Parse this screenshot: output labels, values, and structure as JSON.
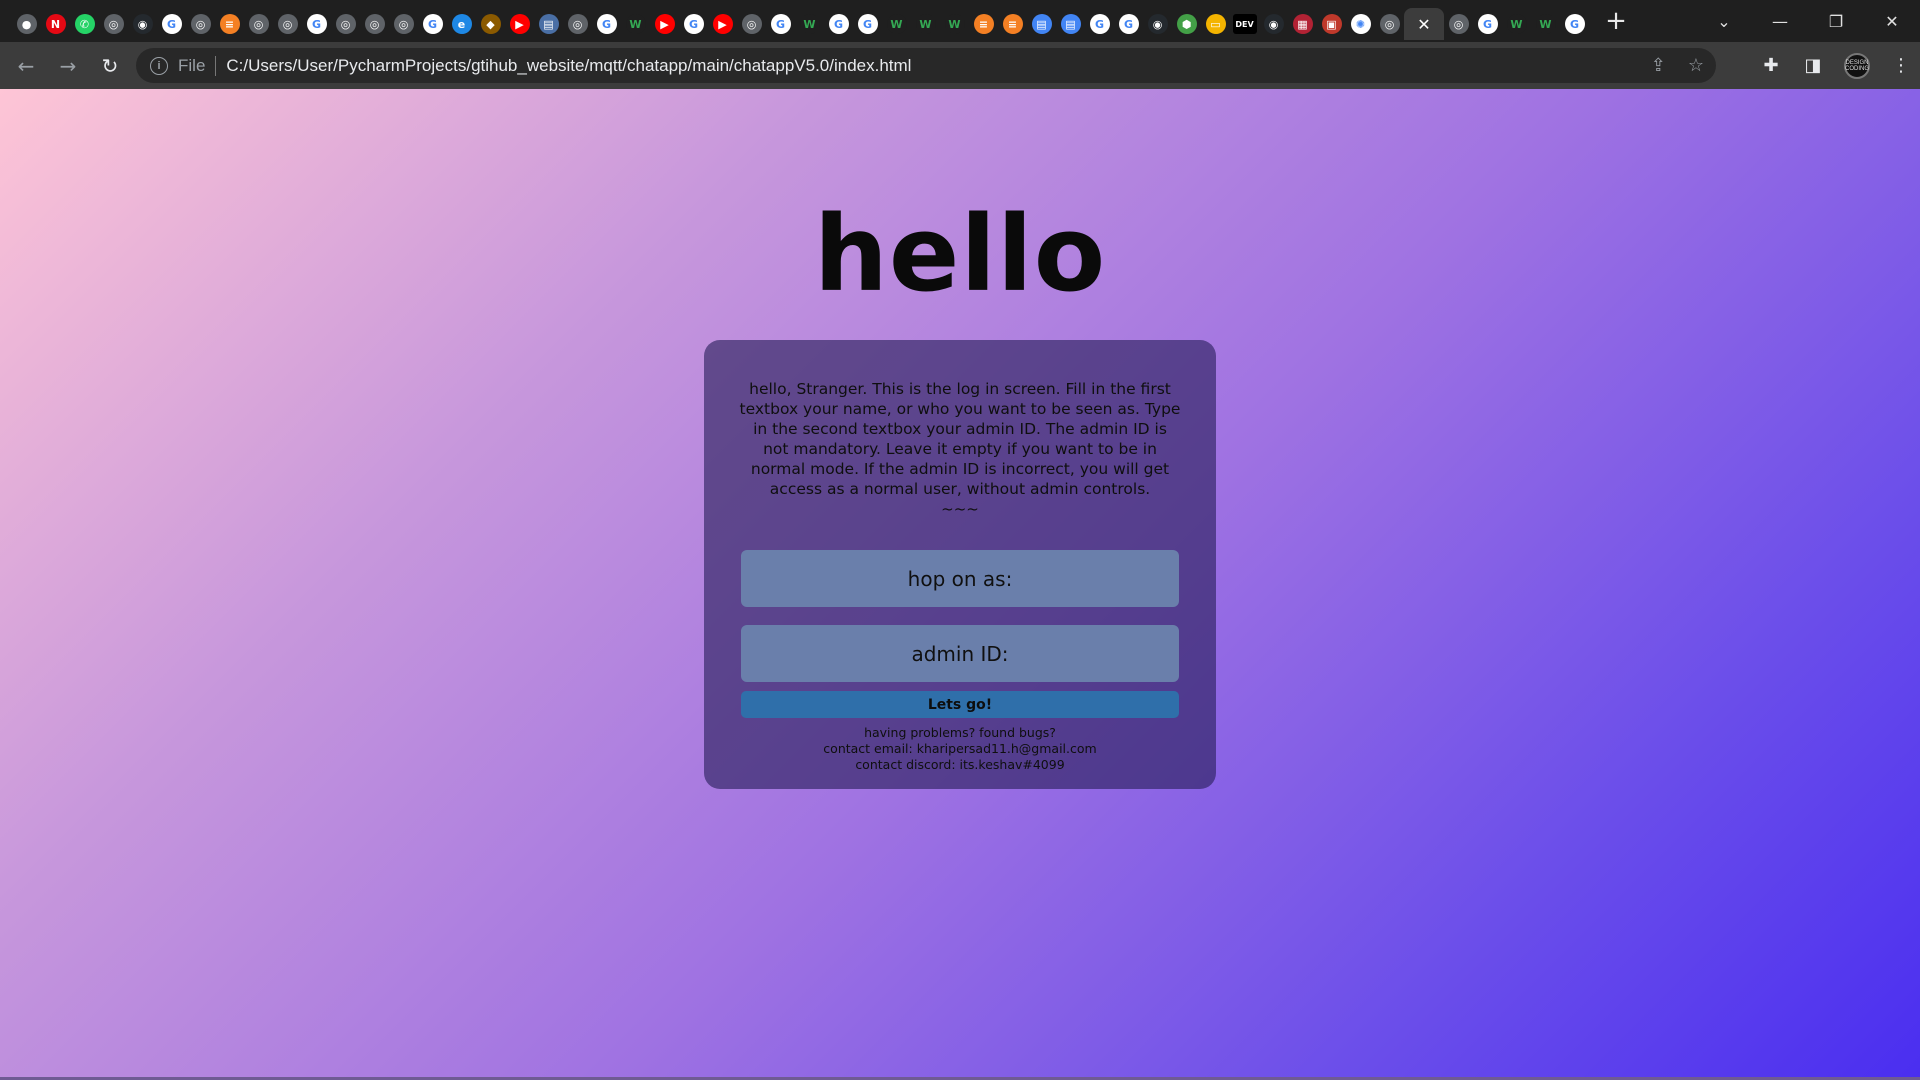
{
  "tabs": [
    {
      "icon": "chrome-icon",
      "color": "#5f6368",
      "glyph": "●"
    },
    {
      "icon": "netflix-icon",
      "color": "#e50914",
      "glyph": "N"
    },
    {
      "icon": "whatsapp-icon",
      "color": "#25d366",
      "glyph": "✆"
    },
    {
      "icon": "globe-icon",
      "color": "#5f6368",
      "glyph": "◎"
    },
    {
      "icon": "github-icon",
      "color": "#24292e",
      "glyph": "◉"
    },
    {
      "icon": "google-icon",
      "color": "#ffffff",
      "glyph": "G"
    },
    {
      "icon": "globe-icon",
      "color": "#5f6368",
      "glyph": "◎"
    },
    {
      "icon": "stackoverflow-icon",
      "color": "#f48024",
      "glyph": "≡"
    },
    {
      "icon": "globe-icon",
      "color": "#5f6368",
      "glyph": "◎"
    },
    {
      "icon": "globe-icon",
      "color": "#5f6368",
      "glyph": "◎"
    },
    {
      "icon": "google-icon",
      "color": "#ffffff",
      "glyph": "G"
    },
    {
      "icon": "globe-icon",
      "color": "#5f6368",
      "glyph": "◎"
    },
    {
      "icon": "globe-icon",
      "color": "#5f6368",
      "glyph": "◎"
    },
    {
      "icon": "globe-icon",
      "color": "#5f6368",
      "glyph": "◎"
    },
    {
      "icon": "google-icon",
      "color": "#ffffff",
      "glyph": "G"
    },
    {
      "icon": "edge-icon",
      "color": "#1e88e5",
      "glyph": "e"
    },
    {
      "icon": "shield-icon",
      "color": "#8b5a00",
      "glyph": "◆"
    },
    {
      "icon": "youtube-icon",
      "color": "#ff0000",
      "glyph": "▶"
    },
    {
      "icon": "document-icon",
      "color": "#4a6fa5",
      "glyph": "▤"
    },
    {
      "icon": "globe-icon",
      "color": "#5f6368",
      "glyph": "◎"
    },
    {
      "icon": "google-icon",
      "color": "#ffffff",
      "glyph": "G"
    },
    {
      "icon": "w-icon",
      "color": "#1f1f1f",
      "glyph": "W"
    },
    {
      "icon": "youtube-icon",
      "color": "#ff0000",
      "glyph": "▶"
    },
    {
      "icon": "google-icon",
      "color": "#ffffff",
      "glyph": "G"
    },
    {
      "icon": "youtube-icon",
      "color": "#ff0000",
      "glyph": "▶"
    },
    {
      "icon": "globe-icon",
      "color": "#5f6368",
      "glyph": "◎"
    },
    {
      "icon": "google-icon",
      "color": "#ffffff",
      "glyph": "G"
    },
    {
      "icon": "w-icon",
      "color": "#1f1f1f",
      "glyph": "W"
    },
    {
      "icon": "google-icon",
      "color": "#ffffff",
      "glyph": "G"
    },
    {
      "icon": "google-icon",
      "color": "#ffffff",
      "glyph": "G"
    },
    {
      "icon": "w-icon",
      "color": "#1f1f1f",
      "glyph": "W"
    },
    {
      "icon": "w-icon",
      "color": "#1f1f1f",
      "glyph": "W"
    },
    {
      "icon": "w-icon",
      "color": "#1f1f1f",
      "glyph": "W"
    },
    {
      "icon": "stackoverflow-icon",
      "color": "#f48024",
      "glyph": "≡"
    },
    {
      "icon": "stackoverflow-icon",
      "color": "#f48024",
      "glyph": "≡"
    },
    {
      "icon": "docs-icon",
      "color": "#4285f4",
      "glyph": "▤"
    },
    {
      "icon": "docs-icon",
      "color": "#4285f4",
      "glyph": "▤"
    },
    {
      "icon": "google-icon",
      "color": "#ffffff",
      "glyph": "G"
    },
    {
      "icon": "google-icon",
      "color": "#ffffff",
      "glyph": "G"
    },
    {
      "icon": "github-icon",
      "color": "#24292e",
      "glyph": "◉"
    },
    {
      "icon": "cube-icon",
      "color": "#43a047",
      "glyph": "⬢"
    },
    {
      "icon": "slides-icon",
      "color": "#f4b400",
      "glyph": "▭"
    },
    {
      "icon": "dev-icon",
      "color": "#000000",
      "glyph": "DEV"
    },
    {
      "icon": "github-icon",
      "color": "#24292e",
      "glyph": "◉"
    },
    {
      "icon": "flag-icon",
      "color": "#b22234",
      "glyph": "▦"
    },
    {
      "icon": "calendar-icon",
      "color": "#c0392b",
      "glyph": "▣"
    },
    {
      "icon": "openai-icon",
      "color": "#ffffff",
      "glyph": "✺"
    },
    {
      "icon": "globe-icon",
      "color": "#5f6368",
      "glyph": "◎"
    },
    {
      "icon": "close-icon",
      "color": "#3c3c3c",
      "glyph": "✕",
      "active": true
    },
    {
      "icon": "globe-icon",
      "color": "#5f6368",
      "glyph": "◎"
    },
    {
      "icon": "google-icon",
      "color": "#ffffff",
      "glyph": "G"
    },
    {
      "icon": "w-icon",
      "color": "#1f1f1f",
      "glyph": "W"
    },
    {
      "icon": "w-icon",
      "color": "#1f1f1f",
      "glyph": "W"
    },
    {
      "icon": "google-icon",
      "color": "#ffffff",
      "glyph": "G"
    }
  ],
  "tabstrip": {
    "new_tab_glyph": "+",
    "tab_search_glyph": "⌄",
    "minimize_glyph": "—",
    "restore_glyph": "❐",
    "close_glyph": "✕"
  },
  "toolbar": {
    "back_glyph": "←",
    "forward_glyph": "→",
    "reload_glyph": "↻",
    "info_glyph": "i",
    "scheme_label": "File",
    "url": "C:/Users/User/PycharmProjects/gtihub_website/mqtt/chatapp/main/chatappV5.0/index.html",
    "share_glyph": "⇪",
    "bookmark_glyph": "☆",
    "extensions_glyph": "✚",
    "sidepanel_glyph": "◨",
    "avatar_text": "DESIGN CODING",
    "menu_glyph": "⋮"
  },
  "page": {
    "title": "hello",
    "intro": "hello, Stranger. This is the log in screen. Fill in the first textbox your name, or who you want to be seen as. Type in the second textbox your admin ID. The admin ID is not mandatory. Leave it empty if you want to be in normal mode. If the admin ID is incorrect, you will get access as a normal user, without admin controls.",
    "tilde": "~~~",
    "name_placeholder": "hop on as:",
    "admin_placeholder": "admin ID:",
    "go_label": "Lets go!",
    "footer_line1": "having problems? found bugs?",
    "footer_line2": "contact email: kharipersad11.h@gmail.com",
    "footer_line3": "contact discord: its.keshav#4099"
  }
}
